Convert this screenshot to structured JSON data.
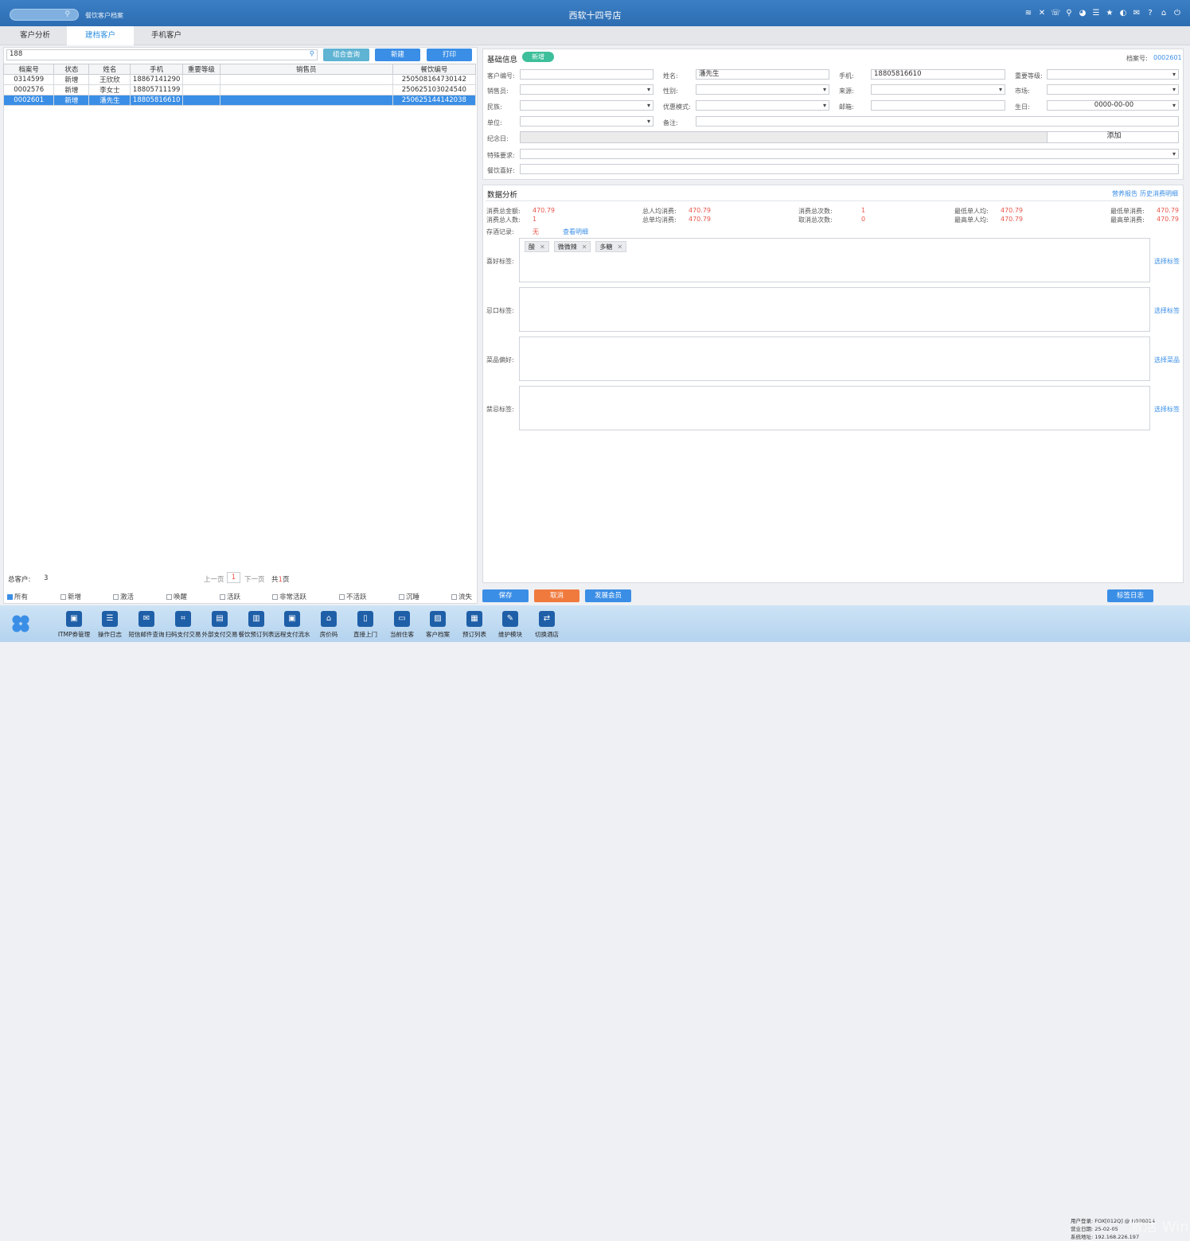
{
  "header": {
    "crumb": "餐饮客户档案",
    "title": "西软十四号店",
    "icons": [
      "wifi-icon",
      "tools-icon",
      "phone-icon",
      "search-user-icon",
      "palette-icon",
      "list-icon",
      "star-icon",
      "contrast-icon",
      "mail-icon",
      "help-icon",
      "home-icon",
      "power-icon"
    ]
  },
  "tabs": [
    "客户分析",
    "建档客户",
    "手机客户"
  ],
  "left": {
    "search_value": "188",
    "buttons": {
      "combo": "组合查询",
      "new": "新建",
      "print": "打印"
    },
    "columns": [
      "档案号",
      "状态",
      "姓名",
      "手机",
      "重要等级",
      "销售员",
      "餐饮编号"
    ],
    "rows": [
      [
        "0314599",
        "新增",
        "王欣欣",
        "18867141290",
        "",
        "",
        "250508164730142"
      ],
      [
        "0002576",
        "新增",
        "李女士",
        "18805711199",
        "",
        "",
        "250625103024540"
      ],
      [
        "0002601",
        "新增",
        "潘先生",
        "18805816610",
        "",
        "",
        "250625144142038"
      ]
    ],
    "total_label": "总客户:",
    "total_value": "3",
    "pager": {
      "prev": "上一页",
      "page": "1",
      "next": "下一页",
      "total_prefix": "共",
      "total_num": "1",
      "total_suffix": "页"
    },
    "filters": [
      "所有",
      "新增",
      "激活",
      "唤醒",
      "活跃",
      "非常活跃",
      "不活跃",
      "沉睡",
      "流失"
    ]
  },
  "basic": {
    "title": "基础信息",
    "badge": "新增",
    "file_label": "档案号:",
    "file_no": "0002601",
    "labels": {
      "cust_no": "客户编号:",
      "name": "姓名:",
      "mobile": "手机:",
      "level": "重要等级:",
      "sales": "销售员:",
      "gender": "性别:",
      "source": "来源:",
      "market": "市场:",
      "nation": "民族:",
      "discount": "优惠模式:",
      "email": "邮箱:",
      "birthday": "生日:",
      "unit": "单位:",
      "note": "备注:",
      "anniv": "纪念日:",
      "special": "特殊要求:",
      "pref": "餐饮喜好:"
    },
    "values": {
      "name": "潘先生",
      "mobile": "18805816610",
      "birthday": "0000-00-00"
    },
    "add_btn": "添加"
  },
  "analysis": {
    "title": "数据分析",
    "links": {
      "report": "营养报告",
      "history": "历史消费明细",
      "view": "查看明细"
    },
    "stats": [
      {
        "label": "消费总金额:",
        "value": "470.79"
      },
      {
        "label": "总人均消费:",
        "value": "470.79"
      },
      {
        "label": "消费总次数:",
        "value": "1"
      },
      {
        "label": "最低单人均:",
        "value": "470.79"
      },
      {
        "label": "最低单消费:",
        "value": "470.79"
      },
      {
        "label": "消费总人数:",
        "value": "1"
      },
      {
        "label": "总单均消费:",
        "value": "470.79"
      },
      {
        "label": "取消总次数:",
        "value": "0"
      },
      {
        "label": "最高单人均:",
        "value": "470.79"
      },
      {
        "label": "最高单消费:",
        "value": "470.79"
      }
    ],
    "wine_label": "存酒记录:",
    "wine_value": "无",
    "tag_rows": [
      {
        "label": "喜好标签:",
        "action": "选择标签",
        "chips": [
          "酸",
          "微微辣",
          "多糖"
        ]
      },
      {
        "label": "忌口标签:",
        "action": "选择标签",
        "chips": []
      },
      {
        "label": "菜品偏好:",
        "action": "选择菜品",
        "chips": []
      },
      {
        "label": "禁忌标签:",
        "action": "选择标签",
        "chips": []
      }
    ]
  },
  "actions": {
    "save": "保存",
    "cancel": "取消",
    "member": "发展会员",
    "log": "标签日志"
  },
  "dock": [
    {
      "label": "ITMP券管理",
      "icon": "ticket-icon"
    },
    {
      "label": "操作日志",
      "icon": "log-icon"
    },
    {
      "label": "短信邮件查询",
      "icon": "mail-icon"
    },
    {
      "label": "扫码支付交易",
      "icon": "scan-icon"
    },
    {
      "label": "外部支付交易",
      "icon": "receipt-icon"
    },
    {
      "label": "餐饮预订列表",
      "icon": "clipboard-icon"
    },
    {
      "label": "远程支付流水",
      "icon": "remote-pay-icon"
    },
    {
      "label": "房价码",
      "icon": "home-icon"
    },
    {
      "label": "直接上门",
      "icon": "door-icon"
    },
    {
      "label": "当前住客",
      "icon": "guest-card-icon"
    },
    {
      "label": "客户档案",
      "icon": "profile-icon"
    },
    {
      "label": "预订列表",
      "icon": "booking-icon"
    },
    {
      "label": "维护模块",
      "icon": "wrench-icon"
    },
    {
      "label": "切换酒店",
      "icon": "switch-icon"
    }
  ],
  "sysinfo": {
    "user": "用户登录: FOX[012Q] @ H000014",
    "date": "营业日期: 25-02-05",
    "ip": "系统地址: 192.168.226.197"
  },
  "watermark": "激活 Win"
}
